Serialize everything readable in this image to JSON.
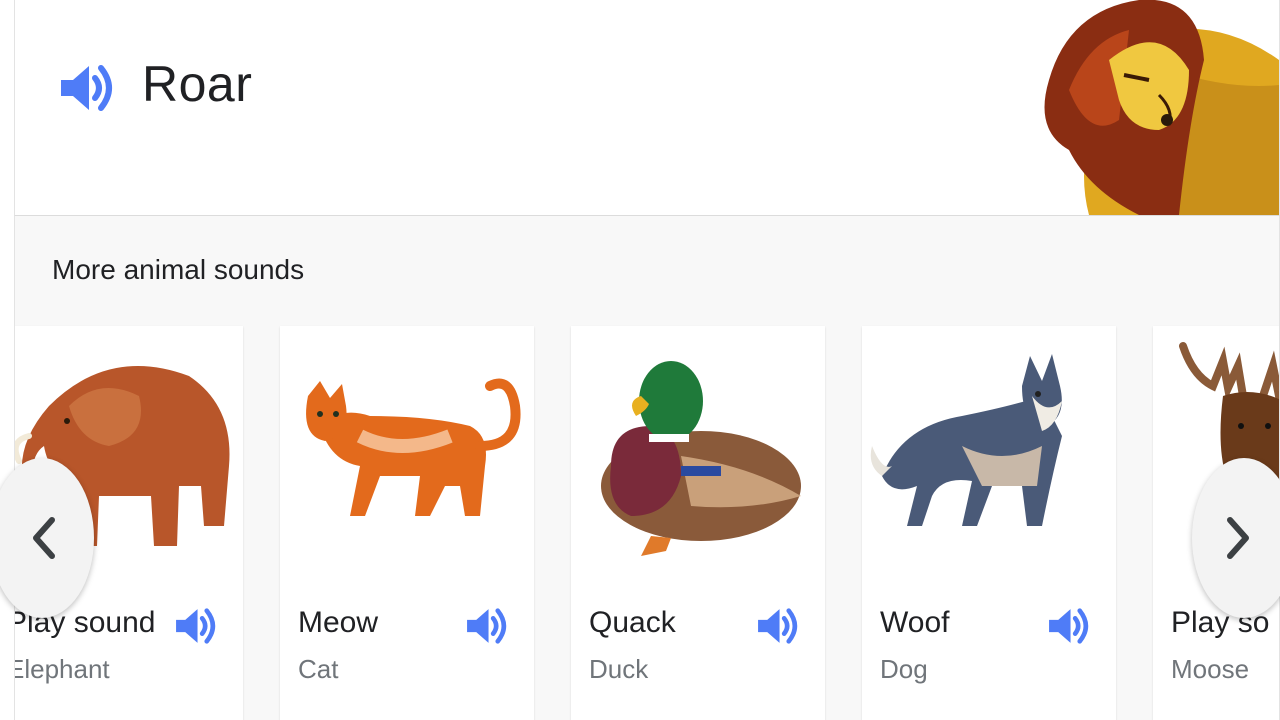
{
  "header": {
    "title": "Roar"
  },
  "section": {
    "title": "More animal sounds"
  },
  "cards": [
    {
      "sound": "Play sound",
      "animal": "Elephant",
      "image": "elephant-image"
    },
    {
      "sound": "Meow",
      "animal": "Cat",
      "image": "cat-image"
    },
    {
      "sound": "Quack",
      "animal": "Duck",
      "image": "duck-image"
    },
    {
      "sound": "Woof",
      "animal": "Dog",
      "image": "dog-image"
    },
    {
      "sound": "Play so",
      "animal": "Moose",
      "image": "moose-image"
    }
  ],
  "icons": {
    "speaker": "speaker-icon",
    "prev": "chevron-left-icon",
    "next": "chevron-right-icon"
  },
  "colors": {
    "accent": "#4f7cf7"
  }
}
